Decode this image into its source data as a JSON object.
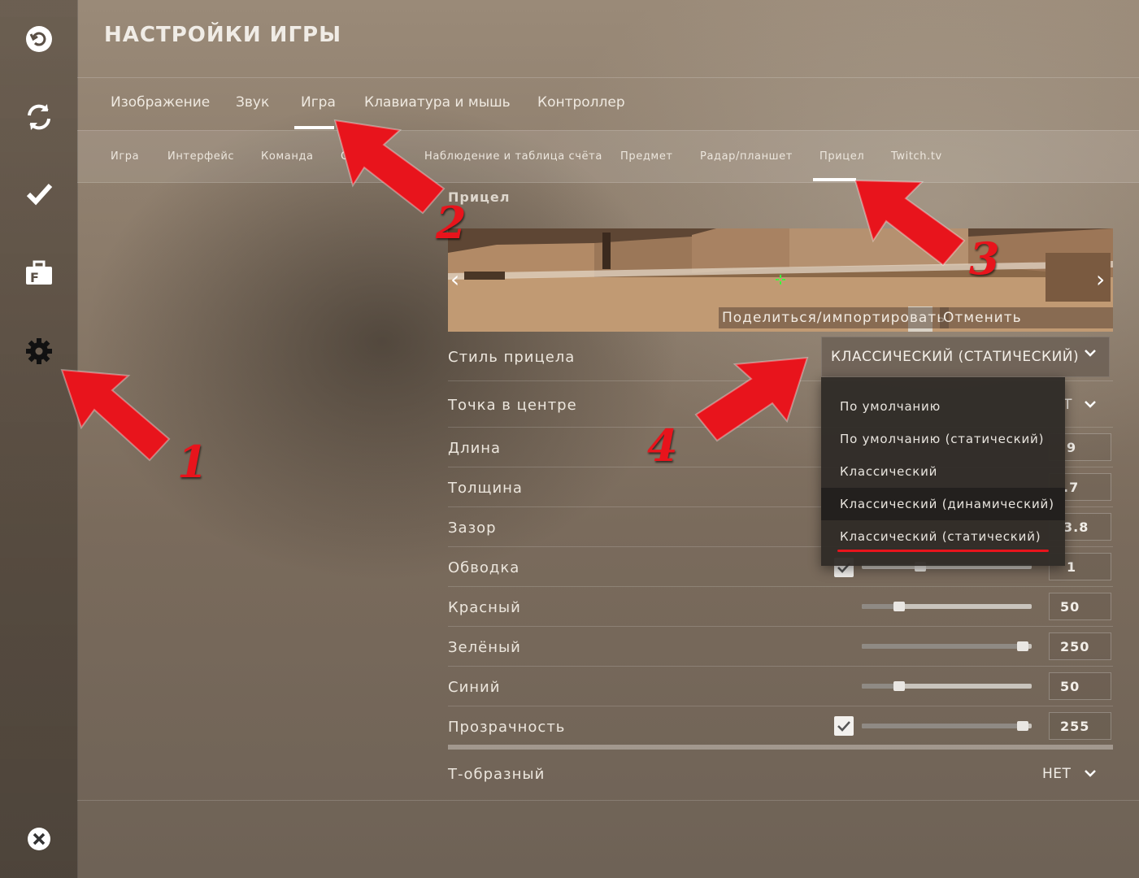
{
  "app": {
    "title": "НАСТРОЙКИ ИГРЫ"
  },
  "rail": {
    "icons": [
      "undo-icon",
      "sync-icon",
      "check-icon",
      "briefcase-icon",
      "gear-icon",
      "close-icon"
    ]
  },
  "tabs": [
    {
      "label": "Изображение"
    },
    {
      "label": "Звук"
    },
    {
      "label": "Игра",
      "active": true
    },
    {
      "label": "Клавиатура и мышь"
    },
    {
      "label": "Контроллер"
    }
  ],
  "subtabs": [
    {
      "label": "Игра"
    },
    {
      "label": "Интерфейс"
    },
    {
      "label": "Команда"
    },
    {
      "label": "О"
    },
    {
      "label": "Наблюдение и таблица счёта"
    },
    {
      "label": "Предмет"
    },
    {
      "label": "Радар/планшет"
    },
    {
      "label": "Прицел",
      "active": true
    },
    {
      "label": "Twitch.tv"
    }
  ],
  "section": {
    "title": "Прицел"
  },
  "preview": {
    "share_label": "Поделиться/импортировать",
    "revert_label": "Отменить изменения"
  },
  "crosshair_style": {
    "label": "Стиль прицела",
    "value": "КЛАССИЧЕСКИЙ (СТАТИЧЕСКИЙ)",
    "options": [
      "По умолчанию",
      "По умолчанию (статический)",
      "Классический",
      "Классический (динамический)",
      "Классический (статический)"
    ],
    "hovered_option": "Классический (динамический)",
    "selected_option": "Классический (статический)"
  },
  "rows": {
    "center_dot": {
      "label": "Точка в центре",
      "value_partial": "Т"
    },
    "length": {
      "label": "Длина",
      "value_partial": "9"
    },
    "thickness": {
      "label": "Толщина",
      "value_partial": ".7"
    },
    "gap": {
      "label": "Зазор",
      "value_partial": "3.8"
    },
    "outline": {
      "label": "Обводка",
      "value_partial": "1",
      "checked": true
    },
    "red": {
      "label": "Красный",
      "value": "50",
      "level": 0.2
    },
    "green": {
      "label": "Зелёный",
      "value": "250",
      "level": 0.98
    },
    "blue": {
      "label": "Синий",
      "value": "50",
      "level": 0.2
    },
    "alpha": {
      "label": "Прозрачность",
      "value": "255",
      "level": 0.98,
      "checked": true
    },
    "t_style": {
      "label": "Т-образный",
      "value": "НЕТ"
    }
  },
  "annotations": [
    "1",
    "2",
    "3",
    "4"
  ],
  "colors": {
    "annotation_red": "#e8141c",
    "accent_white": "#ffffff"
  }
}
